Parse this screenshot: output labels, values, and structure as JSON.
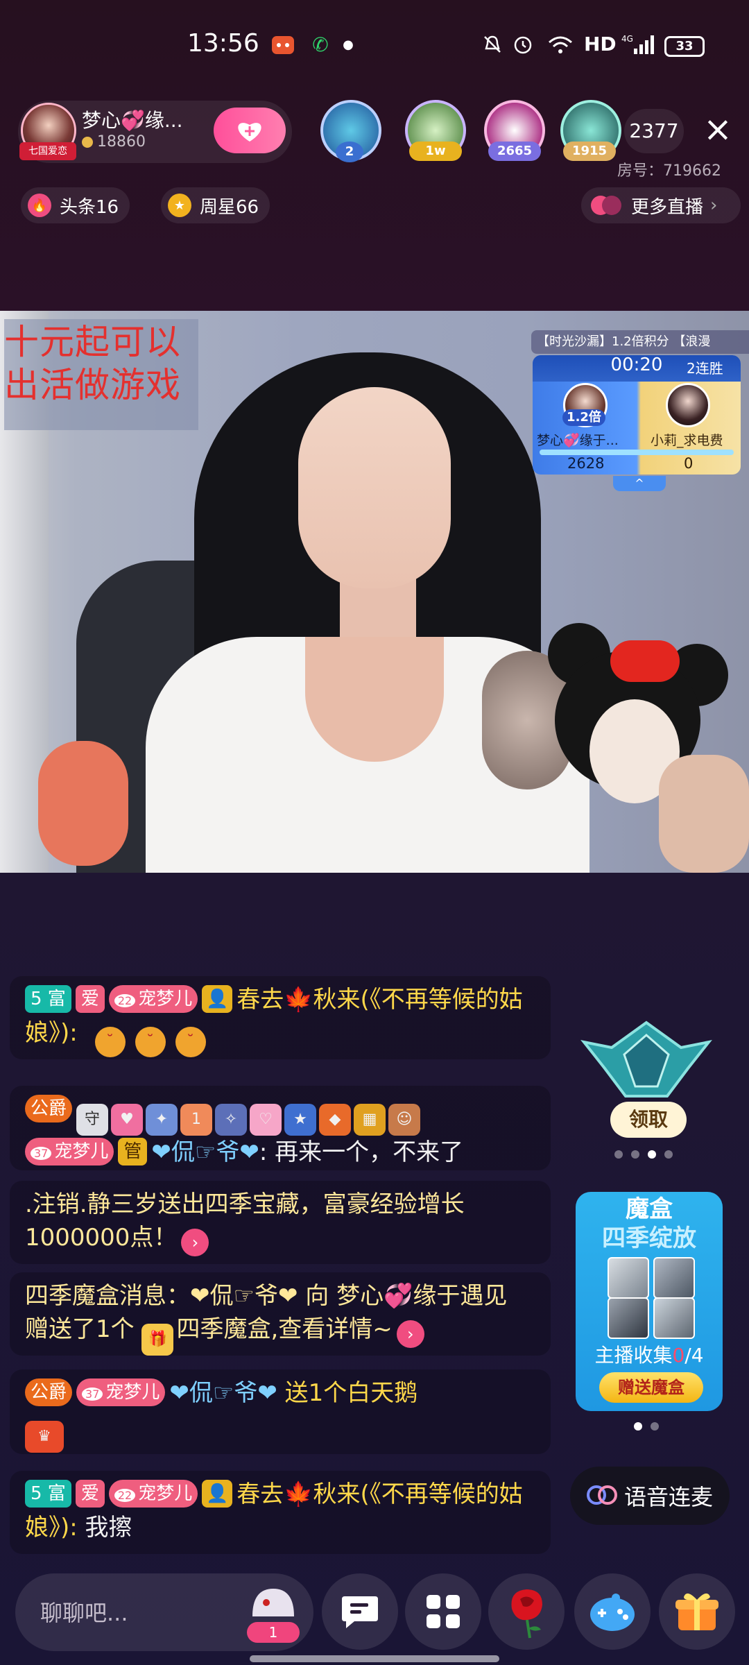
{
  "status_bar": {
    "time": "13:56",
    "network": "HD",
    "cell": "4G",
    "battery": "33"
  },
  "host": {
    "name": "梦心💞缘...",
    "coins": "18860",
    "tag": "七国爱恋",
    "follow_icon": "heart-plus-icon"
  },
  "viewers": [
    {
      "badge": "2",
      "badge_color": "#3a6fd0",
      "ring": "#bcd0ff"
    },
    {
      "badge": "1w",
      "badge_color": "#e8b21f",
      "ring": "#c9b4ff"
    },
    {
      "badge": "2665",
      "badge_color": "#7a6ee0",
      "ring": "#f8b8e0"
    },
    {
      "badge": "1915",
      "badge_color": "#e0b060",
      "ring": "#9ef0e0"
    }
  ],
  "viewer_count": "2377",
  "room_no": "房号：719662",
  "chips": {
    "headline": "头条16",
    "weekly_star": "周星66",
    "more_live": "更多直播",
    "more_arrow": "›"
  },
  "video": {
    "promo_line1": "十元起可以",
    "promo_line2": "出活做游戏"
  },
  "pk": {
    "banner": "【时光沙漏】1.2倍积分 【浪漫",
    "timer": "00:20",
    "streak": "2连胜",
    "multiplier": "1.2倍",
    "left_name": "梦心💞缘于...",
    "right_name": "小莉_求电费",
    "left_score": "2628",
    "right_score": "0",
    "toggle": "^"
  },
  "chat": [
    {
      "rich": "5 富",
      "love": "爱",
      "pet": "宠梦儿",
      "pet_level": "22",
      "user": "春去🍁秋来(《不再等候的姑娘》):",
      "text": ""
    },
    {
      "duke": "公爵",
      "pet_level": "37",
      "pet": "宠梦儿",
      "guan": "管",
      "user": "❤侃☞爷❤",
      "text": ": 再来一个，不来了"
    },
    {
      "text": ".注销.静三岁送出四季宝藏，富豪经验增长1000000点！"
    },
    {
      "prefix": "四季魔盒消息：",
      "user": "❤侃☞爷❤",
      "mid": " 向 梦心💞缘于遇见 赠送了1个 ",
      "item": "四季魔盒,查看详情~"
    },
    {
      "duke": "公爵",
      "pet_level": "37",
      "pet": "宠梦儿",
      "user": "❤侃☞爷❤",
      "text": " 送1个白天鹅"
    },
    {
      "rich": "5 富",
      "love": "爱",
      "pet": "宠梦儿",
      "pet_level": "22",
      "user": "春去🍁秋来(《不再等候的姑娘》):",
      "text": " 我擦"
    }
  ],
  "widgets": {
    "claim": "领取",
    "magic_title1": "魔盒",
    "magic_title2": "四季绽放",
    "magic_collect_prefix": "主播收集",
    "magic_collect_have": "0",
    "magic_collect_total": "/4",
    "magic_button": "赠送魔盒",
    "voice_link": "语音连麦"
  },
  "bottom": {
    "chat_placeholder": "聊聊吧...",
    "fan_badge": "1"
  }
}
